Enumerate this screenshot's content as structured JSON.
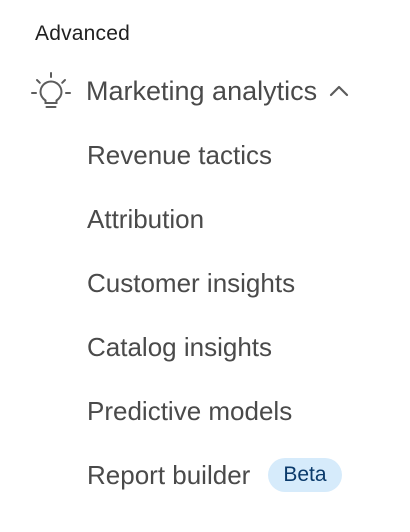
{
  "section": {
    "title": "Advanced"
  },
  "group": {
    "label": "Marketing analytics",
    "icon": "lightbulb-icon",
    "expanded": true,
    "chevron_icon": "chevron-up-icon"
  },
  "items": [
    {
      "label": "Revenue tactics"
    },
    {
      "label": "Attribution"
    },
    {
      "label": "Customer insights"
    },
    {
      "label": "Catalog insights"
    },
    {
      "label": "Predictive models"
    },
    {
      "label": "Report builder",
      "badge": "Beta"
    }
  ],
  "colors": {
    "text": "#4a4a4a",
    "title": "#1f1f1f",
    "badge_bg": "#d6ebfb",
    "badge_text": "#0a3a6b"
  }
}
